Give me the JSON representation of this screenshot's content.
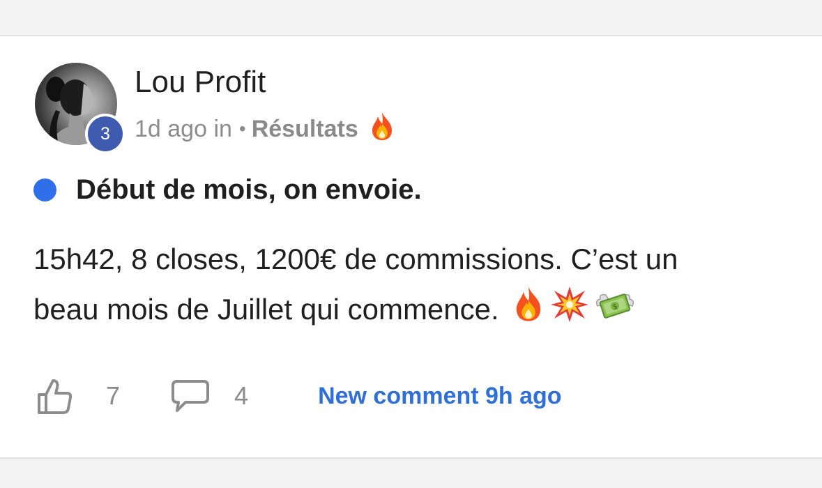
{
  "post": {
    "author": {
      "name": "Lou Profit",
      "level": "3",
      "avatar": "avatar-photo"
    },
    "meta": {
      "time": "1d ago in",
      "separator": "•",
      "category": "Résultats",
      "category_emoji": "fire-icon"
    },
    "unread_indicator_color": "#2f6fea",
    "title": "Début de mois, on envoie.",
    "body": {
      "line1": "15h42, 8 closes, 1200€ de commissions. C’est un",
      "line2": "beau mois de Juillet qui commence.",
      "emojis": [
        "fire-icon",
        "collision-icon",
        "money-with-wings-icon"
      ]
    },
    "actions": {
      "likes": "7",
      "like_icon": "thumbs-up-icon",
      "comments": "4",
      "comment_icon": "speech-bubble-icon",
      "new_comment_text": "New comment 9h ago"
    }
  },
  "colors": {
    "link_blue": "#2f6fd8",
    "badge_blue": "#3f5bb0",
    "muted_gray": "#8c8c8c"
  }
}
